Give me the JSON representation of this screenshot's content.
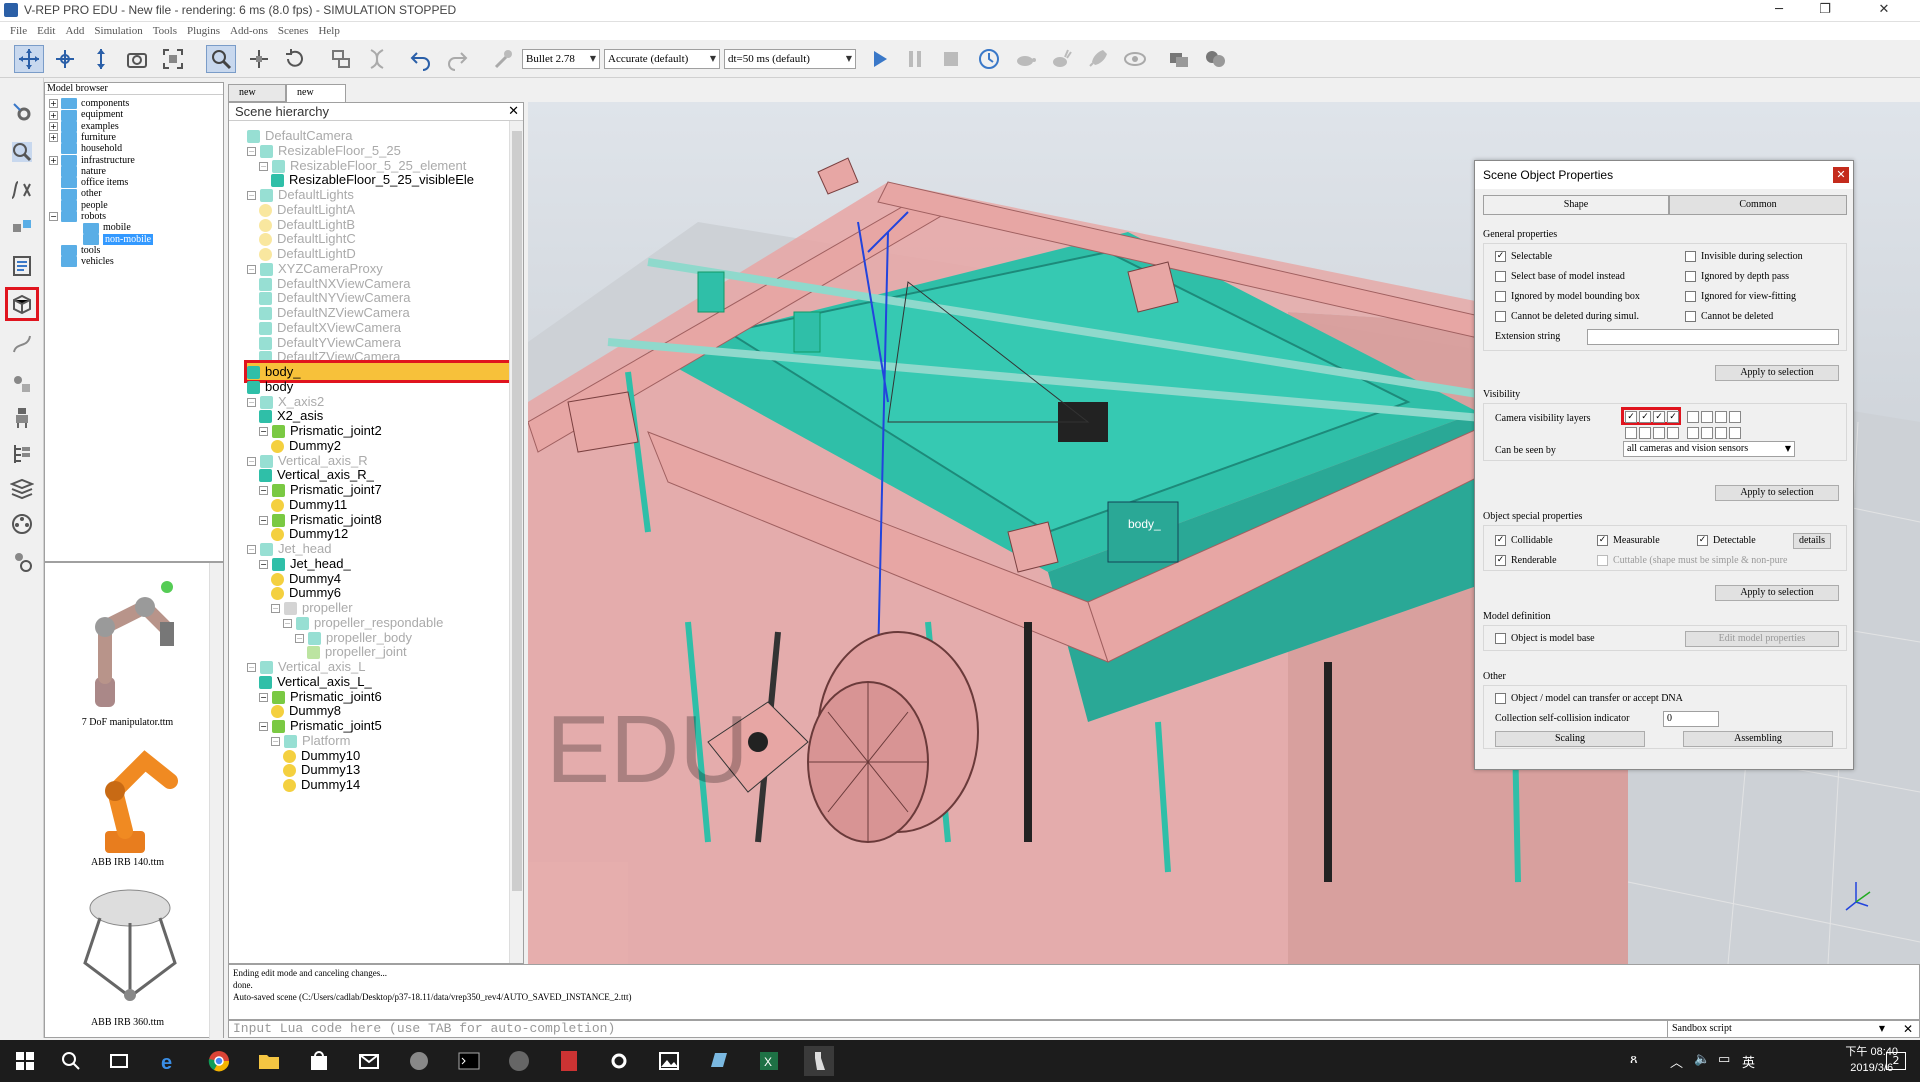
{
  "app": {
    "title": "V-REP PRO EDU - New file - rendering: 6 ms (8.0 fps) - SIMULATION STOPPED"
  },
  "menu": [
    "File",
    "Edit",
    "Add",
    "Simulation",
    "Tools",
    "Plugins",
    "Add-ons",
    "Scenes",
    "Help"
  ],
  "toolbar": {
    "engine": "Bullet 2.78",
    "accuracy": "Accurate (default)",
    "timestep": "dt=50 ms (default)"
  },
  "model_browser": {
    "header": "Model browser",
    "items": [
      {
        "label": "components",
        "exp": "+",
        "depth": 0
      },
      {
        "label": "equipment",
        "exp": "+",
        "depth": 0
      },
      {
        "label": "examples",
        "exp": "+",
        "depth": 0
      },
      {
        "label": "furniture",
        "exp": "+",
        "depth": 0
      },
      {
        "label": "household",
        "exp": "",
        "depth": 0
      },
      {
        "label": "infrastructure",
        "exp": "+",
        "depth": 0
      },
      {
        "label": "nature",
        "exp": "",
        "depth": 0
      },
      {
        "label": "office items",
        "exp": "",
        "depth": 0
      },
      {
        "label": "other",
        "exp": "",
        "depth": 0
      },
      {
        "label": "people",
        "exp": "",
        "depth": 0
      },
      {
        "label": "robots",
        "exp": "−",
        "depth": 0
      },
      {
        "label": "mobile",
        "exp": "",
        "depth": 1
      },
      {
        "label": "non-mobile",
        "exp": "",
        "depth": 1,
        "selected": true
      },
      {
        "label": "tools",
        "exp": "",
        "depth": 0
      },
      {
        "label": "vehicles",
        "exp": "",
        "depth": 0
      }
    ],
    "thumbnails": [
      "7 DoF manipulator.ttm",
      "ABB IRB 140.ttm",
      "ABB IRB 360.ttm"
    ]
  },
  "scene_tabs": [
    "new scene",
    "new scene"
  ],
  "hierarchy": {
    "title": "Scene hierarchy",
    "items": [
      {
        "label": "DefaultCamera",
        "depth": 1,
        "icon": "camera",
        "grey": true
      },
      {
        "label": "ResizableFloor_5_25",
        "depth": 1,
        "icon": "model",
        "grey": true,
        "exp": "−"
      },
      {
        "label": "ResizableFloor_5_25_element",
        "depth": 2,
        "icon": "shape",
        "grey": true,
        "exp": "−"
      },
      {
        "label": "ResizableFloor_5_25_visibleEle",
        "depth": 3,
        "icon": "shape",
        "grey": false
      },
      {
        "label": "DefaultLights",
        "depth": 1,
        "icon": "model",
        "grey": true,
        "exp": "−"
      },
      {
        "label": "DefaultLightA",
        "depth": 2,
        "icon": "light",
        "grey": true
      },
      {
        "label": "DefaultLightB",
        "depth": 2,
        "icon": "light",
        "grey": true
      },
      {
        "label": "DefaultLightC",
        "depth": 2,
        "icon": "light",
        "grey": true
      },
      {
        "label": "DefaultLightD",
        "depth": 2,
        "icon": "light",
        "grey": true
      },
      {
        "label": "XYZCameraProxy",
        "depth": 1,
        "icon": "model",
        "grey": true,
        "exp": "−"
      },
      {
        "label": "DefaultNXViewCamera",
        "depth": 2,
        "icon": "camera",
        "grey": true
      },
      {
        "label": "DefaultNYViewCamera",
        "depth": 2,
        "icon": "camera",
        "grey": true
      },
      {
        "label": "DefaultNZViewCamera",
        "depth": 2,
        "icon": "camera",
        "grey": true
      },
      {
        "label": "DefaultXViewCamera",
        "depth": 2,
        "icon": "camera",
        "grey": true
      },
      {
        "label": "DefaultYViewCamera",
        "depth": 2,
        "icon": "camera",
        "grey": true
      },
      {
        "label": "DefaultZViewCamera",
        "depth": 2,
        "icon": "camera",
        "grey": true
      },
      {
        "label": "body_",
        "depth": 1,
        "icon": "shape",
        "grey": false,
        "selected": true
      },
      {
        "label": "body",
        "depth": 1,
        "icon": "shape",
        "grey": false
      },
      {
        "label": "X_axis2",
        "depth": 1,
        "icon": "shape",
        "grey": true,
        "exp": "−"
      },
      {
        "label": "X2_asis",
        "depth": 2,
        "icon": "shape",
        "grey": false
      },
      {
        "label": "Prismatic_joint2",
        "depth": 2,
        "icon": "joint",
        "grey": false,
        "exp": "−"
      },
      {
        "label": "Dummy2",
        "depth": 3,
        "icon": "dummy",
        "grey": false
      },
      {
        "label": "Vertical_axis_R",
        "depth": 1,
        "icon": "shape",
        "grey": true,
        "exp": "−"
      },
      {
        "label": "Vertical_axis_R_",
        "depth": 2,
        "icon": "shape",
        "grey": false
      },
      {
        "label": "Prismatic_joint7",
        "depth": 2,
        "icon": "joint",
        "grey": false,
        "exp": "−"
      },
      {
        "label": "Dummy11",
        "depth": 3,
        "icon": "dummy",
        "grey": false
      },
      {
        "label": "Prismatic_joint8",
        "depth": 2,
        "icon": "joint",
        "grey": false,
        "exp": "−"
      },
      {
        "label": "Dummy12",
        "depth": 3,
        "icon": "dummy",
        "grey": false
      },
      {
        "label": "Jet_head",
        "depth": 1,
        "icon": "shape",
        "grey": true,
        "exp": "−"
      },
      {
        "label": "Jet_head_",
        "depth": 2,
        "icon": "shape",
        "grey": false,
        "exp": "−"
      },
      {
        "label": "Dummy4",
        "depth": 3,
        "icon": "dummy",
        "grey": false
      },
      {
        "label": "Dummy6",
        "depth": 3,
        "icon": "dummy",
        "grey": false
      },
      {
        "label": "propeller",
        "depth": 3,
        "icon": "script",
        "grey": true,
        "exp": "−"
      },
      {
        "label": "propeller_respondable",
        "depth": 4,
        "icon": "shape",
        "grey": true,
        "exp": "−"
      },
      {
        "label": "propeller_body",
        "depth": 5,
        "icon": "shape",
        "grey": true,
        "exp": "−"
      },
      {
        "label": "propeller_joint",
        "depth": 6,
        "icon": "joint",
        "grey": true
      },
      {
        "label": "Vertical_axis_L",
        "depth": 1,
        "icon": "shape",
        "grey": true,
        "exp": "−"
      },
      {
        "label": "Vertical_axis_L_",
        "depth": 2,
        "icon": "shape",
        "grey": false
      },
      {
        "label": "Prismatic_joint6",
        "depth": 2,
        "icon": "joint",
        "grey": false,
        "exp": "−"
      },
      {
        "label": "Dummy8",
        "depth": 3,
        "icon": "dummy",
        "grey": false
      },
      {
        "label": "Prismatic_joint5",
        "depth": 2,
        "icon": "joint",
        "grey": false,
        "exp": "−"
      },
      {
        "label": "Platform",
        "depth": 3,
        "icon": "shape",
        "grey": true,
        "exp": "−"
      },
      {
        "label": "Dummy10",
        "depth": 4,
        "icon": "dummy",
        "grey": false
      },
      {
        "label": "Dummy13",
        "depth": 4,
        "icon": "dummy",
        "grey": false
      },
      {
        "label": "Dummy14",
        "depth": 4,
        "icon": "dummy",
        "grey": false
      }
    ]
  },
  "viewport": {
    "watermark": "EDU",
    "object_label": "body_"
  },
  "props": {
    "title": "Scene Object Properties",
    "tabs": [
      "Shape",
      "Common"
    ],
    "general": {
      "header": "General properties",
      "selectable": "Selectable",
      "invisible_sel": "Invisible during selection",
      "select_base": "Select base of model instead",
      "ignored_depth": "Ignored by depth pass",
      "ignored_bbox": "Ignored by model bounding  box",
      "ignored_view": "Ignored for view-fitting",
      "cannot_del_sim": "Cannot be deleted during simul.",
      "cannot_del": "Cannot be deleted",
      "ext_string": "Extension string",
      "apply": "Apply to selection"
    },
    "visibility": {
      "header": "Visibility",
      "layers_label": "Camera visibility layers",
      "seen_by_label": "Can be seen by",
      "seen_by_value": "all cameras and vision sensors",
      "apply": "Apply to selection"
    },
    "special": {
      "header": "Object special properties",
      "collidable": "Collidable",
      "measurable": "Measurable",
      "detectable": "Detectable",
      "details": "details",
      "renderable": "Renderable",
      "cuttable": "Cuttable (shape must be simple & non-pure",
      "apply": "Apply to selection"
    },
    "model": {
      "header": "Model definition",
      "is_base": "Object is model base",
      "edit": "Edit model properties"
    },
    "other": {
      "header": "Other",
      "dna": "Object / model can transfer or accept DNA",
      "collision": "Collection self-collision indicator",
      "collision_value": "0",
      "scaling": "Scaling",
      "assembling": "Assembling"
    }
  },
  "console": {
    "lines": [
      "Ending edit mode and canceling changes...",
      "done.",
      "Auto-saved scene (C:/Users/cadlab/Desktop/p37-18.11/data/vrep350_rev4/AUTO_SAVED_INSTANCE_2.ttt)"
    ],
    "lua_placeholder": "Input Lua code here (use TAB for auto-completion)",
    "sandbox": "Sandbox script"
  },
  "taskbar": {
    "time": "下午 08:40",
    "date": "2019/3/6",
    "badge": "2"
  },
  "colors": {
    "accent": "#e0141e",
    "selection": "#f7c13a",
    "teal": "#2fbfa8",
    "pink": "#e8a0a0"
  }
}
